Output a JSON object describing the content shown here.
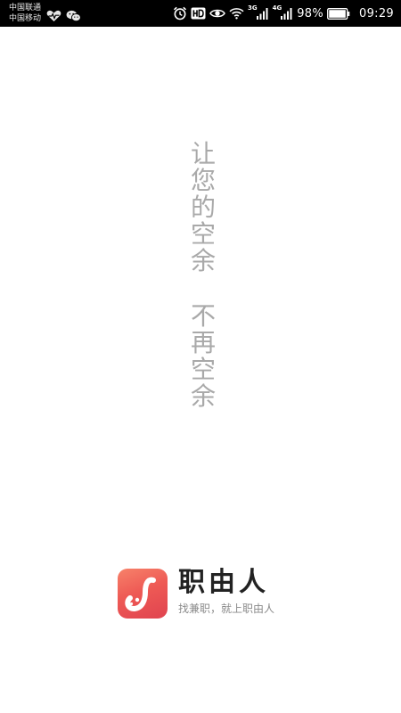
{
  "status_bar": {
    "carrier_1": "中国联通",
    "carrier_2": "中国移动",
    "icons_left": [
      "heart-rate-icon",
      "wechat-icon"
    ],
    "icons_right": [
      "alarm-icon",
      "hd-icon",
      "eye-comfort-icon",
      "wifi-icon",
      "signal-icon",
      "signal-icon",
      "battery-icon"
    ],
    "network_1": "3G",
    "network_2": "4G",
    "battery_percent": "98%",
    "battery_level": 0.98,
    "time": "09:29"
  },
  "slogan": {
    "line_1": [
      "让",
      "您",
      "的",
      "空",
      "余"
    ],
    "line_2": [
      "不",
      "再",
      "空",
      "余"
    ]
  },
  "brand": {
    "name": "职由人",
    "tagline": "找兼职，就上职由人",
    "icon": "app-logo-icon"
  },
  "colors": {
    "status_bar_bg": "#000000",
    "background": "#ffffff",
    "slogan_text": "#a9a9a9",
    "brand_name": "#222222",
    "tagline": "#8a8a8a",
    "logo_gradient_start": "#f7826a",
    "logo_gradient_end": "#e0434f"
  }
}
